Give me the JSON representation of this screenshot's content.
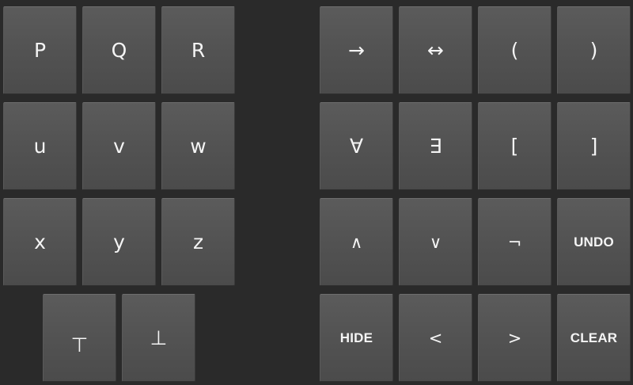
{
  "keyboard": {
    "left": {
      "row0": [
        "P",
        "Q",
        "R"
      ],
      "row1": [
        "u",
        "v",
        "w"
      ],
      "row2": [
        "x",
        "y",
        "z"
      ],
      "row3": [
        "⊤",
        "⊥"
      ]
    },
    "right": {
      "row0": [
        "→",
        "↔",
        "(",
        ")"
      ],
      "row1": [
        "∀",
        "∃",
        "[",
        "]"
      ],
      "row2": [
        "∧",
        "∨",
        "¬",
        "UNDO"
      ],
      "row3": [
        "HIDE",
        "<",
        ">",
        "CLEAR"
      ]
    }
  }
}
